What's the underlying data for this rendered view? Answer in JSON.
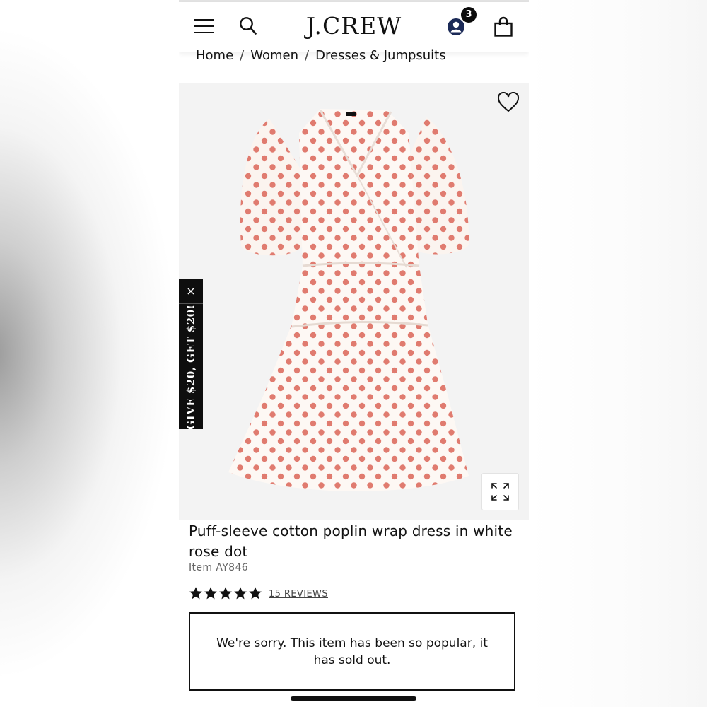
{
  "header": {
    "logo": "J.CREW",
    "cart_badge_count": "3"
  },
  "breadcrumb": {
    "items": [
      "Home",
      "Women",
      "Dresses & Jumpsuits"
    ],
    "separator": "/"
  },
  "promo": {
    "label": "GIVE $20, GET $20!",
    "close": "×"
  },
  "product": {
    "title": "Puff-sleeve cotton poplin wrap dress in white rose dot",
    "item_number": "Item AY846",
    "rating_stars": 5,
    "reviews_label": "15 REVIEWS",
    "sold_out_message": "We're sorry. This item has been so popular, it has sold out.",
    "dot_color": "#e07b6f"
  },
  "icons": [
    "menu-icon",
    "search-icon",
    "account-icon",
    "bag-icon",
    "heart-icon",
    "expand-icon",
    "star-icon"
  ]
}
